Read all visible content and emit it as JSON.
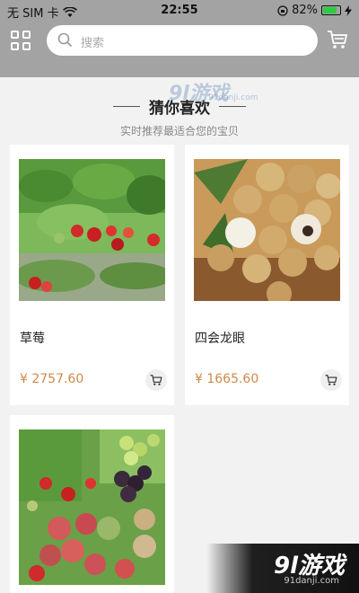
{
  "status_bar": {
    "carrier": "无 SIM 卡",
    "time": "22:55",
    "battery": "82%",
    "battery_level": 0.82
  },
  "search": {
    "placeholder": "搜索"
  },
  "section": {
    "title": "猜你喜欢",
    "subtitle": "实时推荐最适合您的宝贝"
  },
  "products": [
    {
      "name": "草莓",
      "price": "¥ 2757.60"
    },
    {
      "name": "四会龙眼",
      "price": "¥ 1665.60"
    }
  ],
  "watermark": {
    "logo": "9l游戏",
    "site": "91danji.com"
  },
  "colors": {
    "header_bg": "#a3a3a3",
    "price": "#d0884d"
  },
  "icons": [
    "grid-icon",
    "search-icon",
    "cart-icon",
    "wifi-icon",
    "battery-icon",
    "lock-rotation-icon",
    "charging-icon"
  ]
}
